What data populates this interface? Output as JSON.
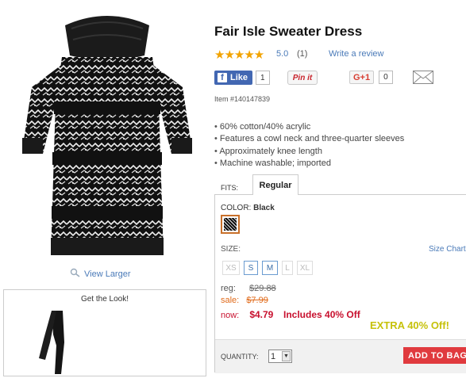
{
  "product": {
    "title": "Fair Isle Sweater Dress",
    "rating_stars": "★★★★★",
    "rating_value": "5.0",
    "review_count": "(1)",
    "write_review": "Write a review",
    "item_number": "Item #140147839",
    "features": [
      "60% cotton/40% acrylic",
      "Features a cowl neck and three-quarter sleeves",
      "Approximately knee length",
      "Machine washable; imported"
    ]
  },
  "social": {
    "fb_label": "Like",
    "fb_icon": "f",
    "fb_count": "1",
    "pin_label": "Pin it",
    "gplus_label": "G+1",
    "gplus_count": "0",
    "mail_icon": "mail-icon"
  },
  "gallery": {
    "view_larger": "View Larger",
    "get_the_look": "Get the Look!"
  },
  "options": {
    "fits_label": "FITS:",
    "fit_tab": "Regular",
    "color_label": "COLOR:",
    "color_value": "Black",
    "size_label": "SIZE:",
    "size_chart": "Size Chart",
    "sizes": [
      "XS",
      "S",
      "M",
      "L",
      "XL"
    ]
  },
  "pricing": {
    "reg_label": "reg:",
    "reg_price": "$29.88",
    "sale_label": "sale:",
    "sale_price": "$7.99",
    "now_label": "now:",
    "now_price": "$4.79",
    "includes_text": "Includes 40% Off",
    "extra_text": "EXTRA 40% Off!"
  },
  "cart": {
    "quantity_label": "QUANTITY:",
    "quantity_value": "1",
    "add_to_bag": "ADD TO BAG"
  },
  "colors": {
    "link": "#4a7ab8",
    "sale": "#e06a1a",
    "now": "#c8102e",
    "extra": "#c6c10a",
    "add_to_bag": "#e03a3e",
    "stars": "#f2a300"
  }
}
